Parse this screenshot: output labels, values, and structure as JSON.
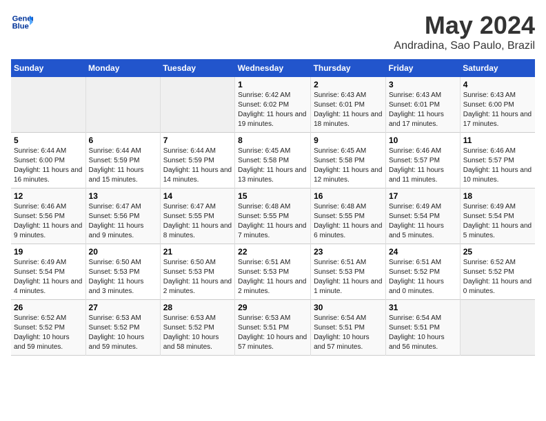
{
  "header": {
    "logo_line1": "General",
    "logo_line2": "Blue",
    "month_title": "May 2024",
    "location": "Andradina, Sao Paulo, Brazil"
  },
  "days_of_week": [
    "Sunday",
    "Monday",
    "Tuesday",
    "Wednesday",
    "Thursday",
    "Friday",
    "Saturday"
  ],
  "weeks": [
    [
      {
        "day": "",
        "info": ""
      },
      {
        "day": "",
        "info": ""
      },
      {
        "day": "",
        "info": ""
      },
      {
        "day": "1",
        "info": "Sunrise: 6:42 AM\nSunset: 6:02 PM\nDaylight: 11 hours and 19 minutes."
      },
      {
        "day": "2",
        "info": "Sunrise: 6:43 AM\nSunset: 6:01 PM\nDaylight: 11 hours and 18 minutes."
      },
      {
        "day": "3",
        "info": "Sunrise: 6:43 AM\nSunset: 6:01 PM\nDaylight: 11 hours and 17 minutes."
      },
      {
        "day": "4",
        "info": "Sunrise: 6:43 AM\nSunset: 6:00 PM\nDaylight: 11 hours and 17 minutes."
      }
    ],
    [
      {
        "day": "5",
        "info": "Sunrise: 6:44 AM\nSunset: 6:00 PM\nDaylight: 11 hours and 16 minutes."
      },
      {
        "day": "6",
        "info": "Sunrise: 6:44 AM\nSunset: 5:59 PM\nDaylight: 11 hours and 15 minutes."
      },
      {
        "day": "7",
        "info": "Sunrise: 6:44 AM\nSunset: 5:59 PM\nDaylight: 11 hours and 14 minutes."
      },
      {
        "day": "8",
        "info": "Sunrise: 6:45 AM\nSunset: 5:58 PM\nDaylight: 11 hours and 13 minutes."
      },
      {
        "day": "9",
        "info": "Sunrise: 6:45 AM\nSunset: 5:58 PM\nDaylight: 11 hours and 12 minutes."
      },
      {
        "day": "10",
        "info": "Sunrise: 6:46 AM\nSunset: 5:57 PM\nDaylight: 11 hours and 11 minutes."
      },
      {
        "day": "11",
        "info": "Sunrise: 6:46 AM\nSunset: 5:57 PM\nDaylight: 11 hours and 10 minutes."
      }
    ],
    [
      {
        "day": "12",
        "info": "Sunrise: 6:46 AM\nSunset: 5:56 PM\nDaylight: 11 hours and 9 minutes."
      },
      {
        "day": "13",
        "info": "Sunrise: 6:47 AM\nSunset: 5:56 PM\nDaylight: 11 hours and 9 minutes."
      },
      {
        "day": "14",
        "info": "Sunrise: 6:47 AM\nSunset: 5:55 PM\nDaylight: 11 hours and 8 minutes."
      },
      {
        "day": "15",
        "info": "Sunrise: 6:48 AM\nSunset: 5:55 PM\nDaylight: 11 hours and 7 minutes."
      },
      {
        "day": "16",
        "info": "Sunrise: 6:48 AM\nSunset: 5:55 PM\nDaylight: 11 hours and 6 minutes."
      },
      {
        "day": "17",
        "info": "Sunrise: 6:49 AM\nSunset: 5:54 PM\nDaylight: 11 hours and 5 minutes."
      },
      {
        "day": "18",
        "info": "Sunrise: 6:49 AM\nSunset: 5:54 PM\nDaylight: 11 hours and 5 minutes."
      }
    ],
    [
      {
        "day": "19",
        "info": "Sunrise: 6:49 AM\nSunset: 5:54 PM\nDaylight: 11 hours and 4 minutes."
      },
      {
        "day": "20",
        "info": "Sunrise: 6:50 AM\nSunset: 5:53 PM\nDaylight: 11 hours and 3 minutes."
      },
      {
        "day": "21",
        "info": "Sunrise: 6:50 AM\nSunset: 5:53 PM\nDaylight: 11 hours and 2 minutes."
      },
      {
        "day": "22",
        "info": "Sunrise: 6:51 AM\nSunset: 5:53 PM\nDaylight: 11 hours and 2 minutes."
      },
      {
        "day": "23",
        "info": "Sunrise: 6:51 AM\nSunset: 5:53 PM\nDaylight: 11 hours and 1 minute."
      },
      {
        "day": "24",
        "info": "Sunrise: 6:51 AM\nSunset: 5:52 PM\nDaylight: 11 hours and 0 minutes."
      },
      {
        "day": "25",
        "info": "Sunrise: 6:52 AM\nSunset: 5:52 PM\nDaylight: 11 hours and 0 minutes."
      }
    ],
    [
      {
        "day": "26",
        "info": "Sunrise: 6:52 AM\nSunset: 5:52 PM\nDaylight: 10 hours and 59 minutes."
      },
      {
        "day": "27",
        "info": "Sunrise: 6:53 AM\nSunset: 5:52 PM\nDaylight: 10 hours and 59 minutes."
      },
      {
        "day": "28",
        "info": "Sunrise: 6:53 AM\nSunset: 5:52 PM\nDaylight: 10 hours and 58 minutes."
      },
      {
        "day": "29",
        "info": "Sunrise: 6:53 AM\nSunset: 5:51 PM\nDaylight: 10 hours and 57 minutes."
      },
      {
        "day": "30",
        "info": "Sunrise: 6:54 AM\nSunset: 5:51 PM\nDaylight: 10 hours and 57 minutes."
      },
      {
        "day": "31",
        "info": "Sunrise: 6:54 AM\nSunset: 5:51 PM\nDaylight: 10 hours and 56 minutes."
      },
      {
        "day": "",
        "info": ""
      }
    ]
  ]
}
